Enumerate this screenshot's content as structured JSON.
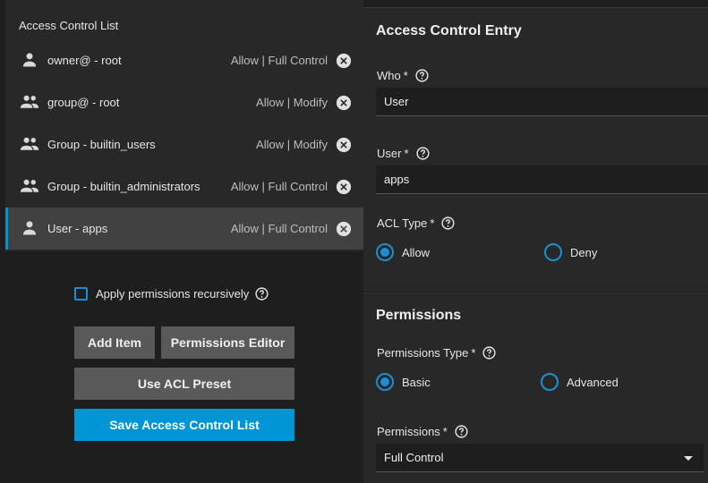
{
  "acl": {
    "title": "Access Control List",
    "entries": [
      {
        "icon": "person-icon",
        "who": "owner@ - root",
        "perm": "Allow | Full Control"
      },
      {
        "icon": "group-icon",
        "who": "group@ - root",
        "perm": "Allow | Modify"
      },
      {
        "icon": "group-icon",
        "who": "Group - builtin_users",
        "perm": "Allow | Modify"
      },
      {
        "icon": "group-icon",
        "who": "Group - builtin_administrators",
        "perm": "Allow | Full Control"
      },
      {
        "icon": "person-icon",
        "who": "User - apps",
        "perm": "Allow | Full Control",
        "selected": true
      }
    ],
    "recursive_label": "Apply permissions recursively",
    "recursive_checked": false,
    "buttons": {
      "add_item": "Add Item",
      "permissions_editor": "Permissions Editor",
      "use_acl_preset": "Use ACL Preset",
      "save_acl": "Save Access Control List"
    }
  },
  "entry": {
    "title": "Access Control Entry",
    "who_label": "Who",
    "who_value": "User",
    "user_label": "User",
    "user_value": "apps",
    "acl_type_label": "ACL Type",
    "acl_type_options": [
      "Allow",
      "Deny"
    ],
    "acl_type_selected": "Allow",
    "required_mark": "*"
  },
  "permissions": {
    "title": "Permissions",
    "type_label": "Permissions Type",
    "type_options": [
      "Basic",
      "Advanced"
    ],
    "type_selected": "Basic",
    "perm_label": "Permissions",
    "perm_value": "Full Control"
  },
  "colors": {
    "accent": "#0095d5",
    "background": "#1e1e1e",
    "card": "#282828",
    "selected_row": "#414141",
    "button": "#595959"
  }
}
